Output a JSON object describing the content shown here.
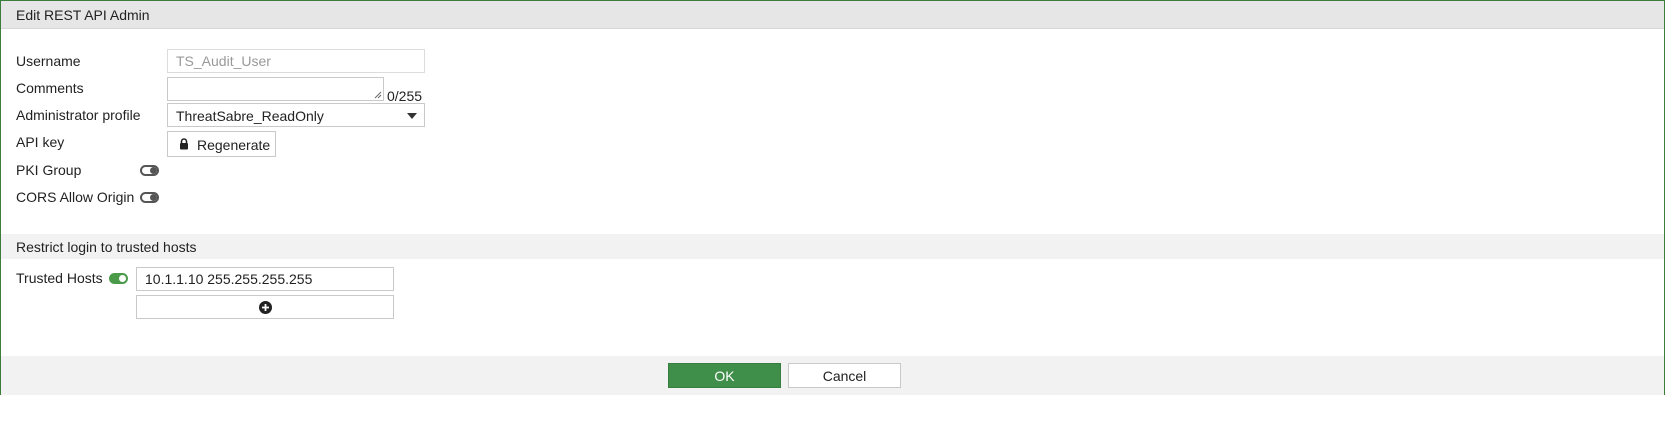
{
  "dialog": {
    "title": "Edit REST API Admin"
  },
  "form": {
    "username": {
      "label": "Username",
      "value": "TS_Audit_User"
    },
    "comments": {
      "label": "Comments",
      "value": "",
      "counter": "0/255"
    },
    "admin_profile": {
      "label": "Administrator profile",
      "value": "ThreatSabre_ReadOnly"
    },
    "api_key": {
      "label": "API key",
      "button_label": "Regenerate"
    },
    "pki_group": {
      "label": "PKI Group",
      "enabled": false
    },
    "cors": {
      "label": "CORS Allow Origin",
      "enabled": false
    }
  },
  "trusted_hosts_section": {
    "title": "Restrict login to trusted hosts",
    "label": "Trusted Hosts",
    "enabled": true,
    "hosts": [
      "10.1.1.10 255.255.255.255"
    ]
  },
  "footer": {
    "ok_label": "OK",
    "cancel_label": "Cancel"
  },
  "colors": {
    "accent": "#3f8f4a",
    "border": "#3b7d3b"
  }
}
